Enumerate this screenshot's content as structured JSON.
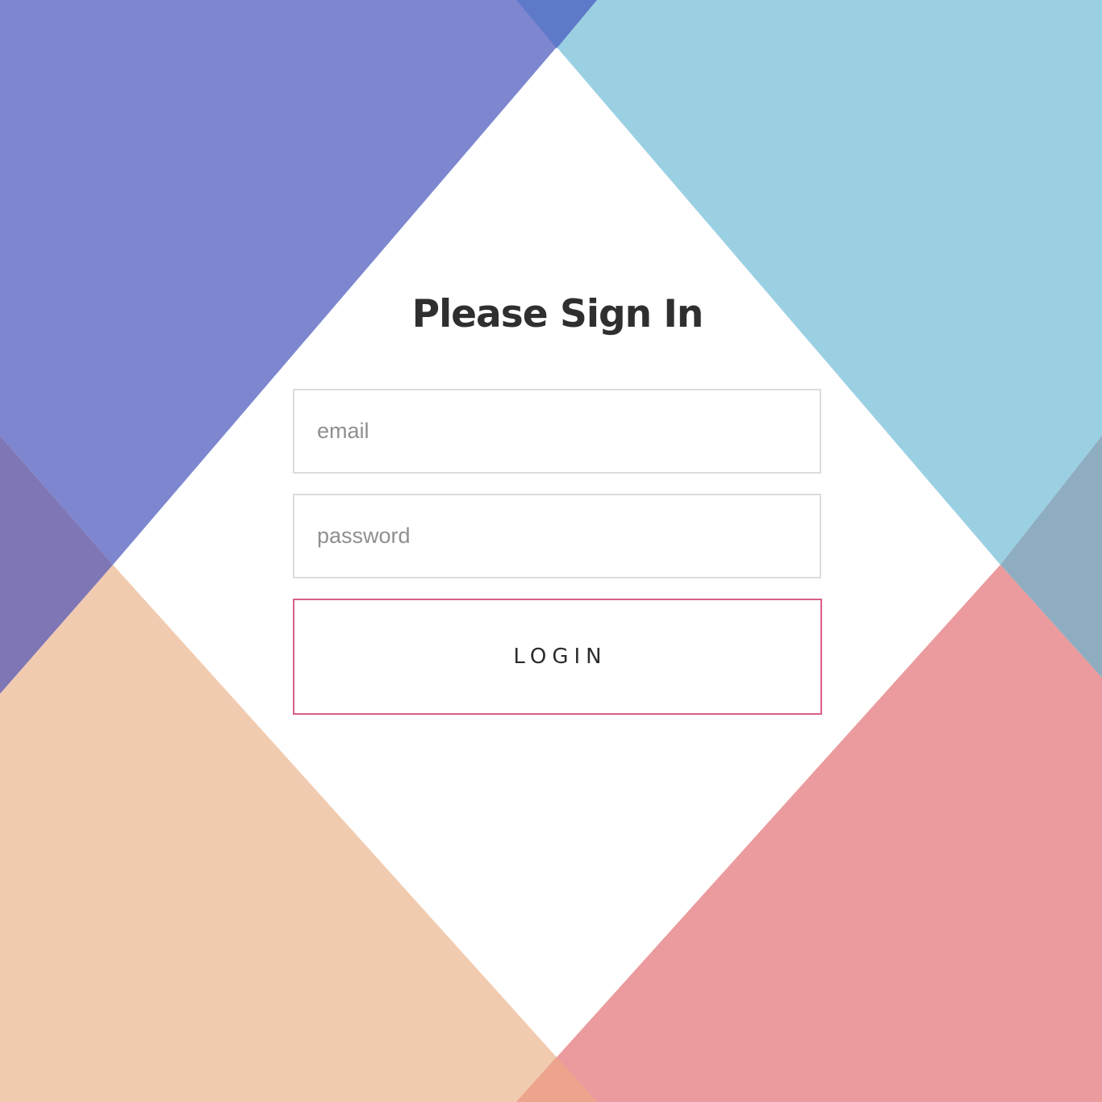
{
  "background": {
    "colors": {
      "top_left": "#7d86cf",
      "top_right": "#9bd0e3",
      "bottom_left": "#f1cbaf",
      "bottom_right": "#eb9b9d",
      "top_overlap": "#5f79c9",
      "left_overlap": "#7f76b5",
      "right_overlap": "#8fadc1",
      "bottom_overlap": "#eda48c"
    }
  },
  "login": {
    "title": "Please Sign In",
    "email_placeholder": "email",
    "password_placeholder": "password",
    "button_label": "LOGIN",
    "button_border_color": "#d95f87"
  }
}
